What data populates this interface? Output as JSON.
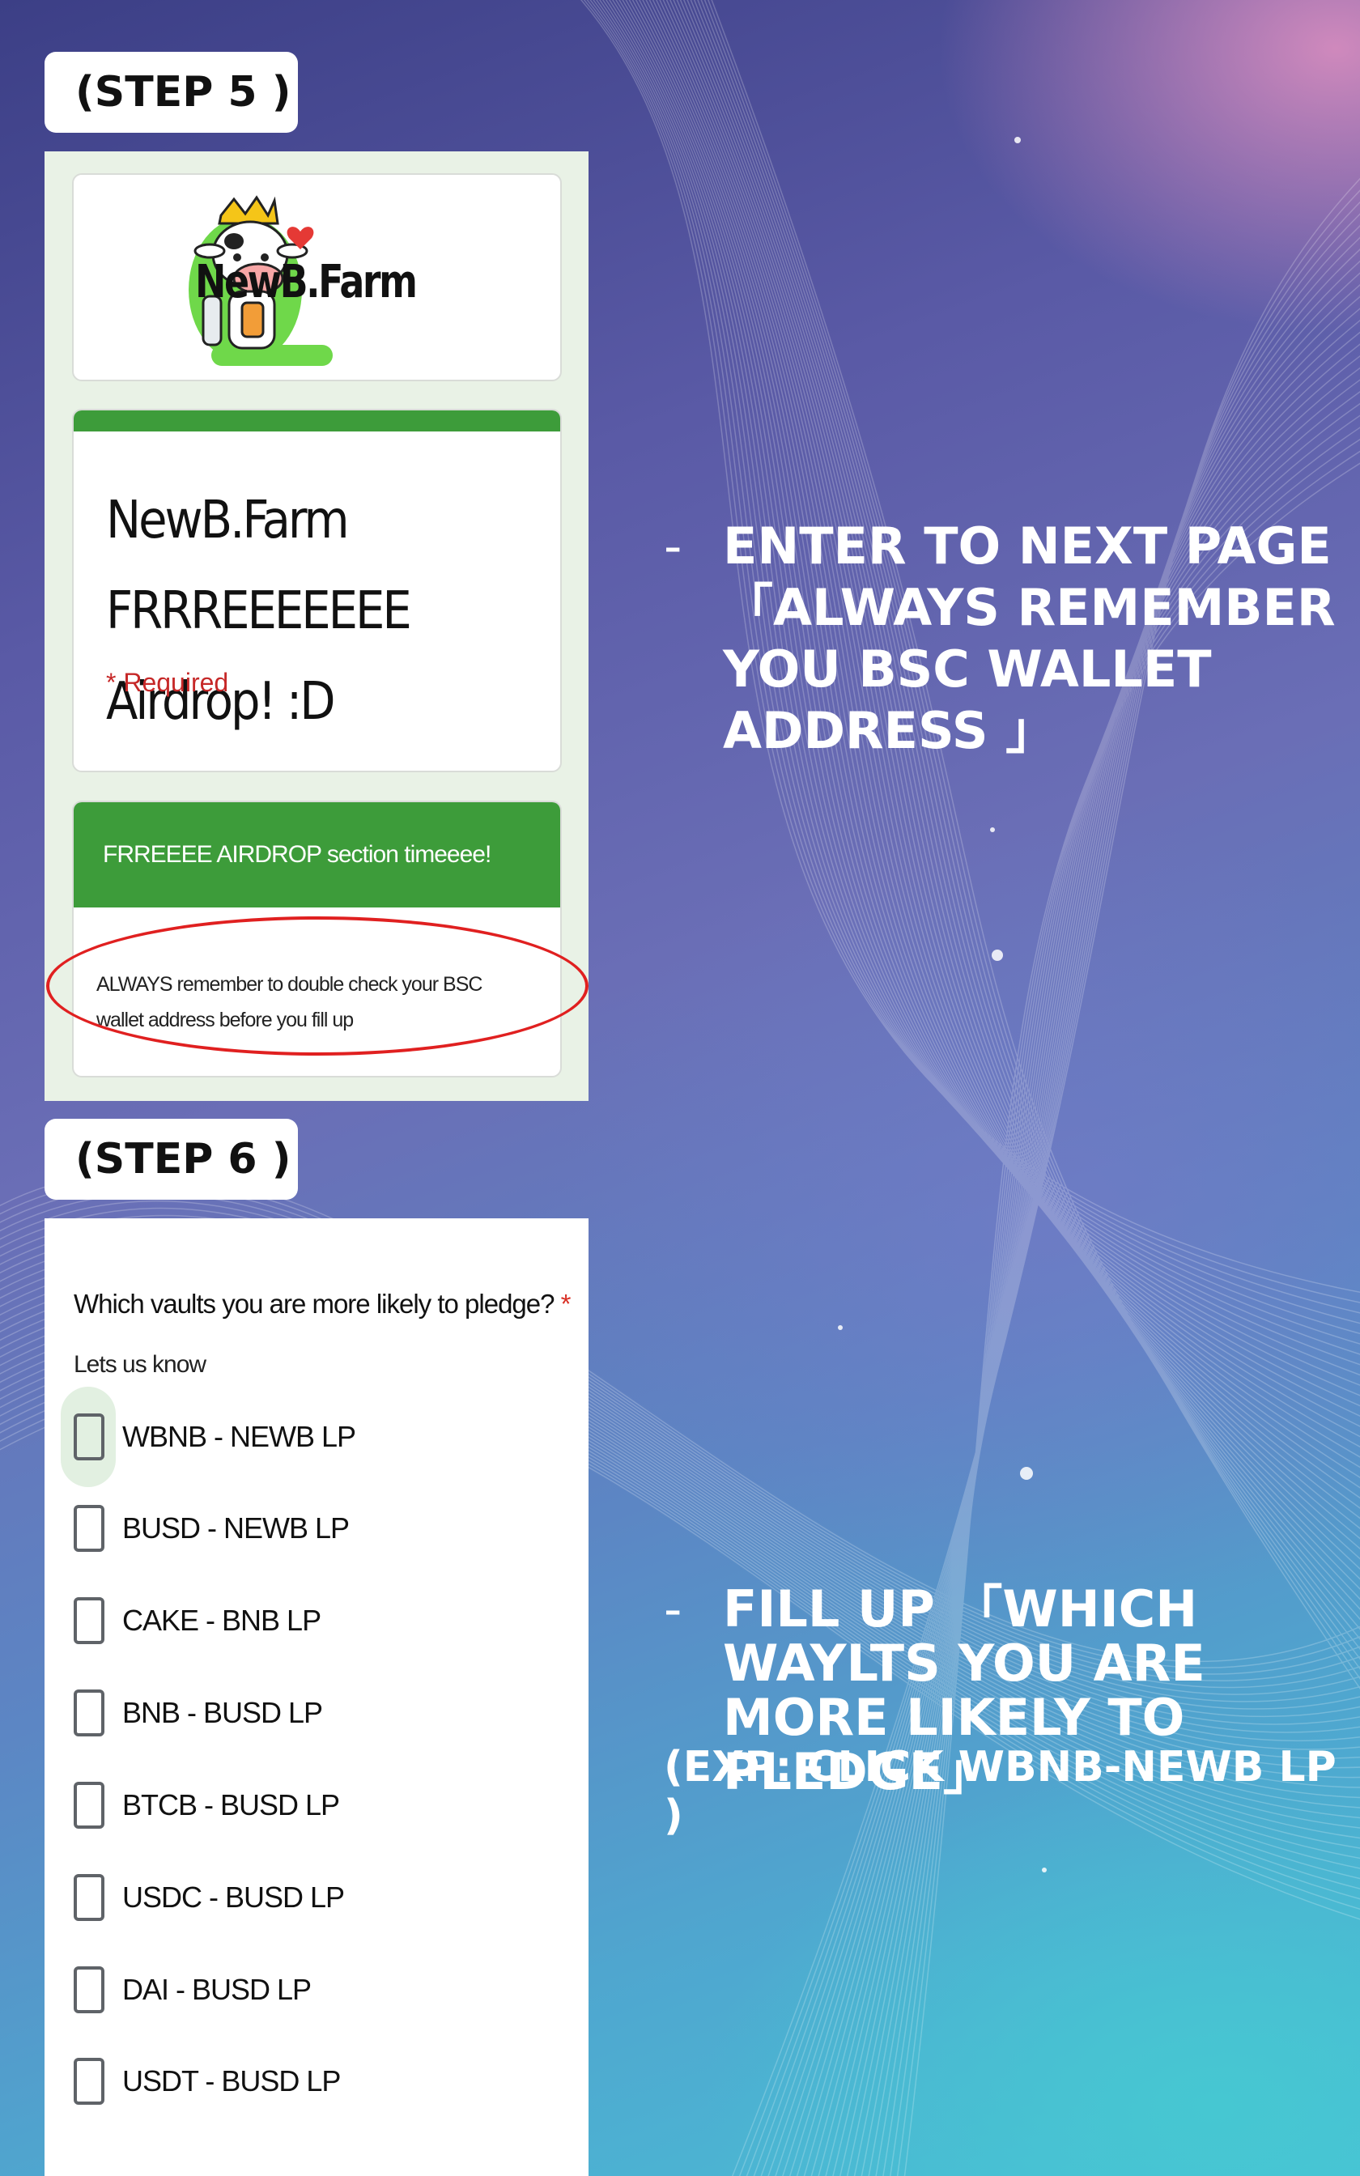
{
  "step5": {
    "label": "(STEP 5 )",
    "logo_text": "NewB.Farm",
    "form_title": "NewB.Farm FRRREEEEEEE Airdrop! :D",
    "required_note": "* Required",
    "section_title": "FRREEEE AIRDROP section timeeee!",
    "section_description": "ALWAYS remember to double check your BSC wallet address before you fill up"
  },
  "step6": {
    "label": "(STEP 6 )",
    "question": "Which vaults you are more likely to pledge?",
    "required_star": "*",
    "help_text": "Lets us know",
    "options": [
      "WBNB - NEWB LP",
      "BUSD - NEWB LP",
      "CAKE - BNB LP",
      "BNB - BUSD LP",
      "BTCB - BUSD LP",
      "USDC - BUSD LP",
      "DAI - BUSD LP",
      "USDT - BUSD LP"
    ]
  },
  "instructions": {
    "first": {
      "dash": "-",
      "text": "ENTER TO NEXT PAGE 「ALWAYS REMEMBER YOU BSC WALLET ADDRESS 」"
    },
    "second": {
      "dash": "-",
      "text": "FILL UP 「WHICH WAYLTS YOU ARE MORE LIKELY TO PLEDGE」",
      "example": "(EXP: CLICK WBNB-NEWB LP )"
    }
  },
  "colors": {
    "form_green": "#3d9c3a",
    "required_red": "#c62828",
    "highlight_red": "#e02020"
  }
}
